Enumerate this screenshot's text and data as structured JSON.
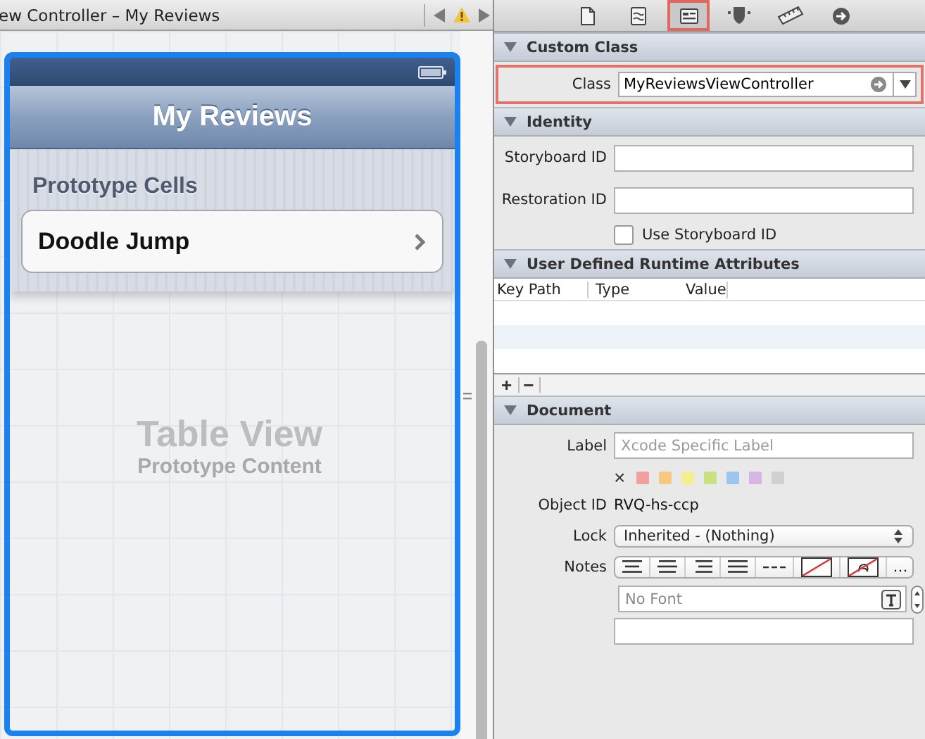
{
  "editor": {
    "title": "ew Controller – My Reviews",
    "warning": true
  },
  "scene": {
    "selected": true,
    "nav_title": "My Reviews",
    "section_header": "Prototype Cells",
    "cells": [
      {
        "title": "Doodle Jump"
      }
    ],
    "placeholder_title": "Table View",
    "placeholder_subtitle": "Prototype Content"
  },
  "inspector": {
    "tabs": [
      {
        "kind": "file",
        "selected": false
      },
      {
        "kind": "help",
        "selected": false
      },
      {
        "kind": "identity",
        "selected": true
      },
      {
        "kind": "attributes",
        "selected": false
      },
      {
        "kind": "size",
        "selected": false
      },
      {
        "kind": "connections",
        "selected": false
      }
    ],
    "custom_class": {
      "title": "Custom Class",
      "expanded": true,
      "label": "Class",
      "value": "MyReviewsViewController",
      "highlighted": true
    },
    "identity": {
      "title": "Identity",
      "expanded": true,
      "fields": [
        {
          "label": "Storyboard ID"
        },
        {
          "label": "Restoration ID"
        }
      ],
      "checkbox": {
        "label": "Use Storyboard ID",
        "checked": false
      }
    },
    "runtime_attributes": {
      "title": "User Defined Runtime Attributes",
      "expanded": true,
      "columns": [
        "Key Path",
        "Type",
        "Value"
      ],
      "buttons": [
        "+",
        "−"
      ]
    },
    "document": {
      "title": "Document",
      "expanded": true,
      "label_field": {
        "label": "Label",
        "placeholder": "Xcode Specific Label"
      },
      "clear_mark": "×",
      "colors": [
        {
          "color": "#f2a0a0"
        },
        {
          "color": "#f6c880"
        },
        {
          "color": "#f3ef8e"
        },
        {
          "color": "#c8e282"
        },
        {
          "color": "#9cc6f0"
        },
        {
          "color": "#d9b4e6"
        },
        {
          "color": "#d0d0d0"
        }
      ],
      "object_id": {
        "label": "Object ID",
        "value": "RVQ-hs-ccp"
      },
      "lock": {
        "label": "Lock",
        "value": "Inherited - (Nothing)"
      },
      "notes": {
        "label": "Notes",
        "more": "…"
      },
      "font": {
        "placeholder": "No Font"
      }
    }
  }
}
